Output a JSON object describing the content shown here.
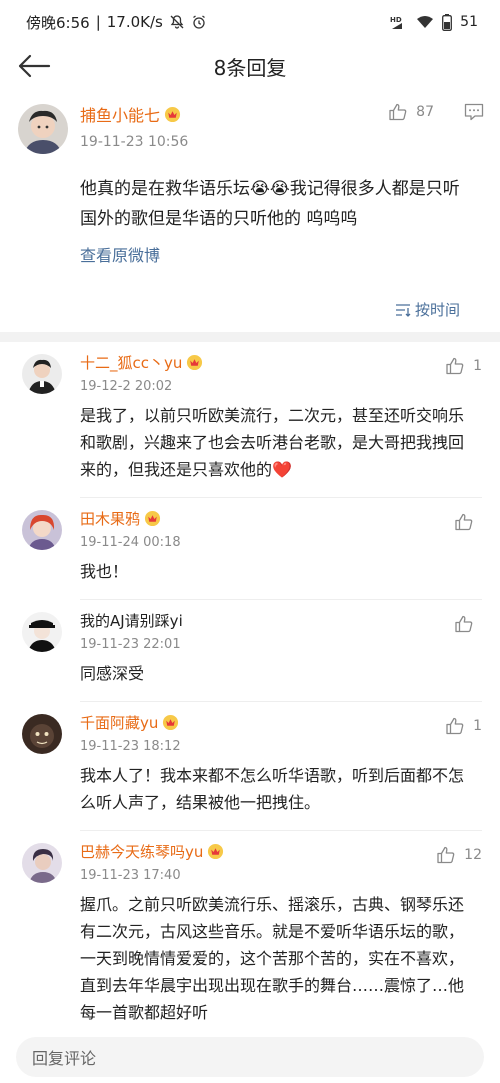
{
  "status_bar": {
    "time": "傍晚6:56",
    "speed": "17.0K/s",
    "battery": "51",
    "icons": [
      "mute-icon",
      "alarm-icon",
      "hd-icon",
      "signal-icon",
      "wifi-icon",
      "battery-icon"
    ]
  },
  "nav": {
    "title": "8条回复"
  },
  "root": {
    "username": "捕鱼小能七",
    "time": "19-11-23 10:56",
    "likes": "87",
    "text": "他真的是在救华语乐坛😭😭我记得很多人都是只听国外的歌但是华语的只听他的 呜呜呜",
    "original_link": "查看原微博",
    "sort_label": "按时间"
  },
  "replies": [
    {
      "username": "十二_狐cc丶yu",
      "time": "19-12-2 20:02",
      "likes": "1",
      "text": "是我了，以前只听欧美流行，二次元，甚至还听交响乐和歌剧，兴趣来了也会去听港台老歌，是大哥把我拽回来的，但我还是只喜欢他的❤️"
    },
    {
      "username": "田木果鸦",
      "time": "19-11-24 00:18",
      "likes": "",
      "text": "我也！"
    },
    {
      "username": "我的AJ请别踩yi",
      "time": "19-11-23 22:01",
      "likes": "",
      "text": "同感深受"
    },
    {
      "username": "千面阿藏yu",
      "time": "19-11-23 18:12",
      "likes": "1",
      "text": "我本人了！我本来都不怎么听华语歌，听到后面都不怎么听人声了，结果被他一把拽住。"
    },
    {
      "username": "巴赫今天练琴吗yu",
      "time": "19-11-23 17:40",
      "likes": "12",
      "text": "握爪。之前只听欧美流行乐、摇滚乐，古典、钢琴乐还有二次元，古风这些音乐。就是不爱听华语乐坛的歌，一天到晚情情爱爱的，这个苦那个苦的，实在不喜欢，直到去年华晨宇出现出现在歌手的舞台……震惊了…他每一首歌都超好听"
    }
  ],
  "bottom": {
    "placeholder": "回复评论"
  },
  "colors": {
    "username": "#e86b16",
    "link": "#4a6f9a",
    "muted": "#8a8a8a"
  }
}
